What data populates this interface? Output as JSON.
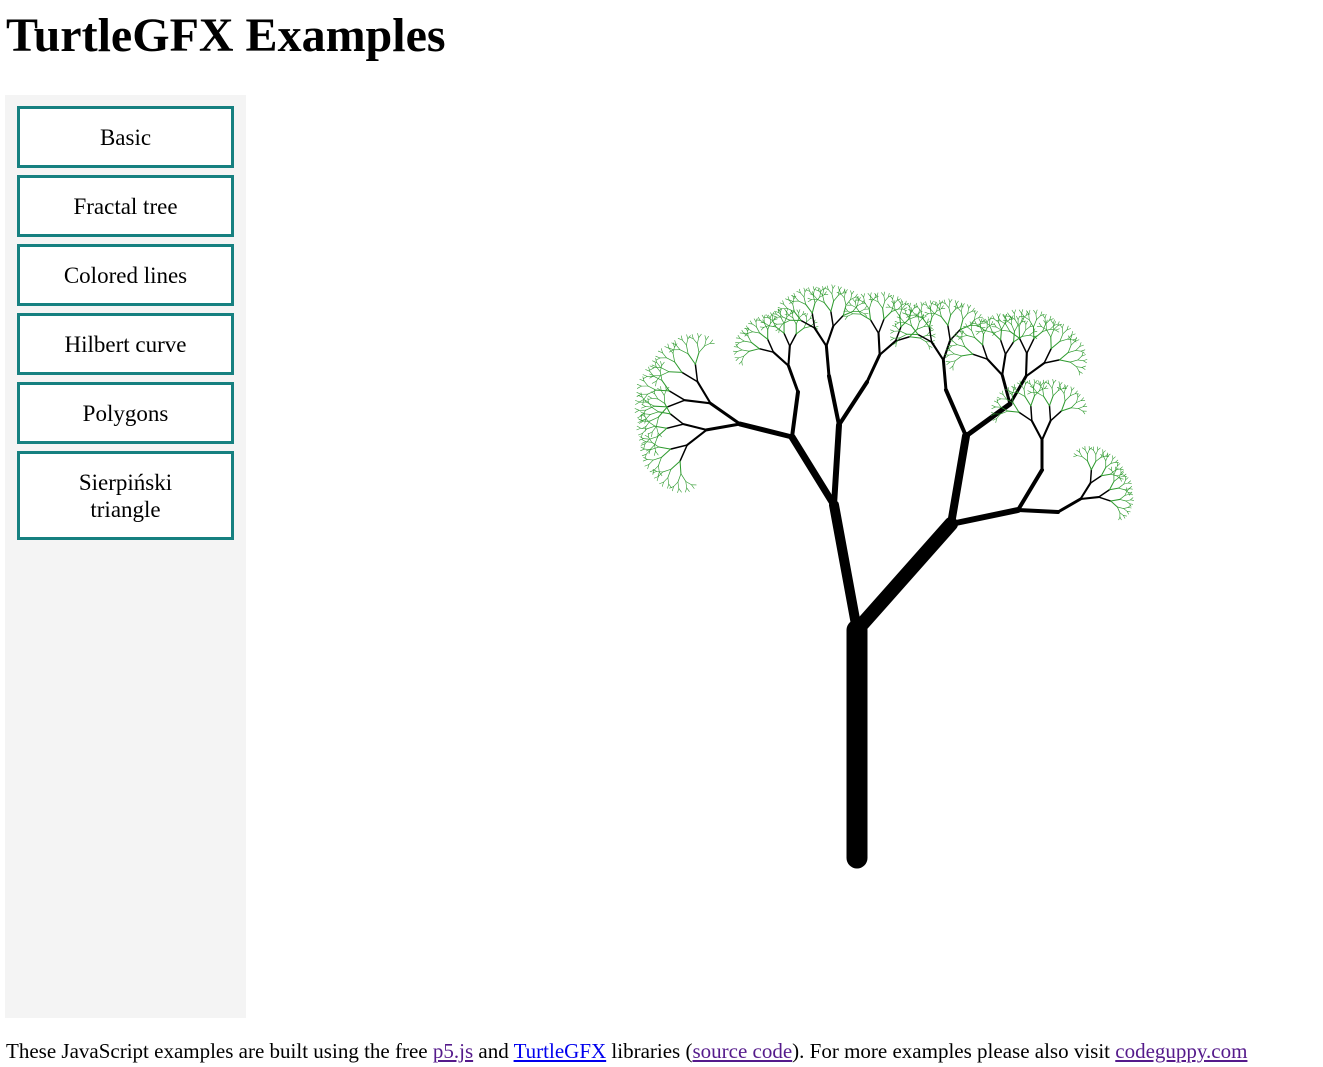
{
  "page": {
    "title": "TurtleGFX Examples"
  },
  "sidebar": {
    "buttons": [
      {
        "label": "Basic"
      },
      {
        "label": "Fractal tree"
      },
      {
        "label": "Colored lines"
      },
      {
        "label": "Hilbert curve"
      },
      {
        "label": "Polygons"
      },
      {
        "label": "Sierpiński triangle"
      }
    ]
  },
  "canvas": {
    "example": "Fractal tree",
    "trunk_color": "#000000",
    "leaf_color": "#2e9a2e"
  },
  "footer": {
    "text_1": "These JavaScript examples are built using the free ",
    "link_p5": "p5.js",
    "text_2": " and ",
    "link_turtlegfx": "TurtleGFX",
    "text_3": " libraries (",
    "link_source": "source code",
    "text_4": "). For more examples please also visit ",
    "link_codeguppy": "codeguppy.com"
  },
  "colors": {
    "button_border": "#168080",
    "sidebar_bg": "#f4f4f4",
    "link_visited": "#551a8b",
    "link_unvisited": "#0000ee"
  }
}
